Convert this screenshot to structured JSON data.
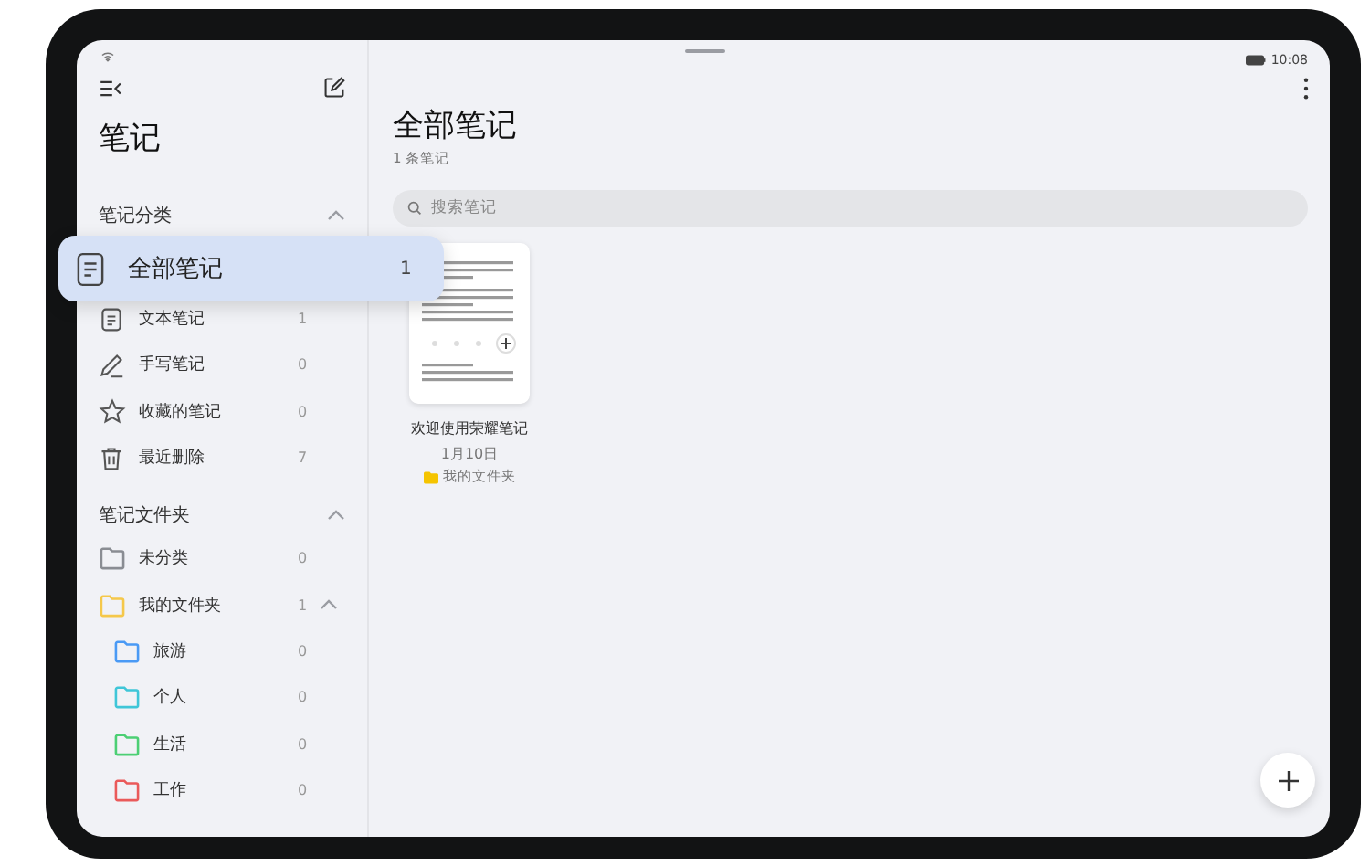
{
  "status_bar": {
    "time": "10:08"
  },
  "sidebar": {
    "title": "笔记",
    "sections": [
      {
        "title": "笔记分类",
        "expanded": true,
        "items": [
          {
            "kind": "text",
            "label": "文本笔记",
            "count": "1"
          },
          {
            "kind": "handwriting",
            "label": "手写笔记",
            "count": "0"
          },
          {
            "kind": "star",
            "label": "收藏的笔记",
            "count": "0"
          },
          {
            "kind": "trash",
            "label": "最近删除",
            "count": "7"
          }
        ]
      },
      {
        "title": "笔记文件夹",
        "expanded": true,
        "items": [
          {
            "kind": "folder",
            "label": "未分类",
            "count": "0",
            "color": "#8a8d93"
          },
          {
            "kind": "folder",
            "label": "我的文件夹",
            "count": "1",
            "color": "#f5c84a",
            "expanded": true,
            "children": [
              {
                "kind": "folder",
                "label": "旅游",
                "count": "0",
                "color": "#4a9af5"
              },
              {
                "kind": "folder",
                "label": "个人",
                "count": "0",
                "color": "#3fc6d8"
              },
              {
                "kind": "folder",
                "label": "生活",
                "count": "0",
                "color": "#4ccf74"
              },
              {
                "kind": "folder",
                "label": "工作",
                "count": "0",
                "color": "#ea5a5a"
              }
            ]
          }
        ]
      }
    ]
  },
  "dragged_item": {
    "label": "全部笔记",
    "count": "1"
  },
  "main": {
    "title": "全部笔记",
    "subtitle": "1 条笔记",
    "search": {
      "placeholder": "搜索笔记"
    },
    "notes": [
      {
        "title": "欢迎使用荣耀笔记",
        "date": "1月10日",
        "folder": "我的文件夹"
      }
    ]
  }
}
